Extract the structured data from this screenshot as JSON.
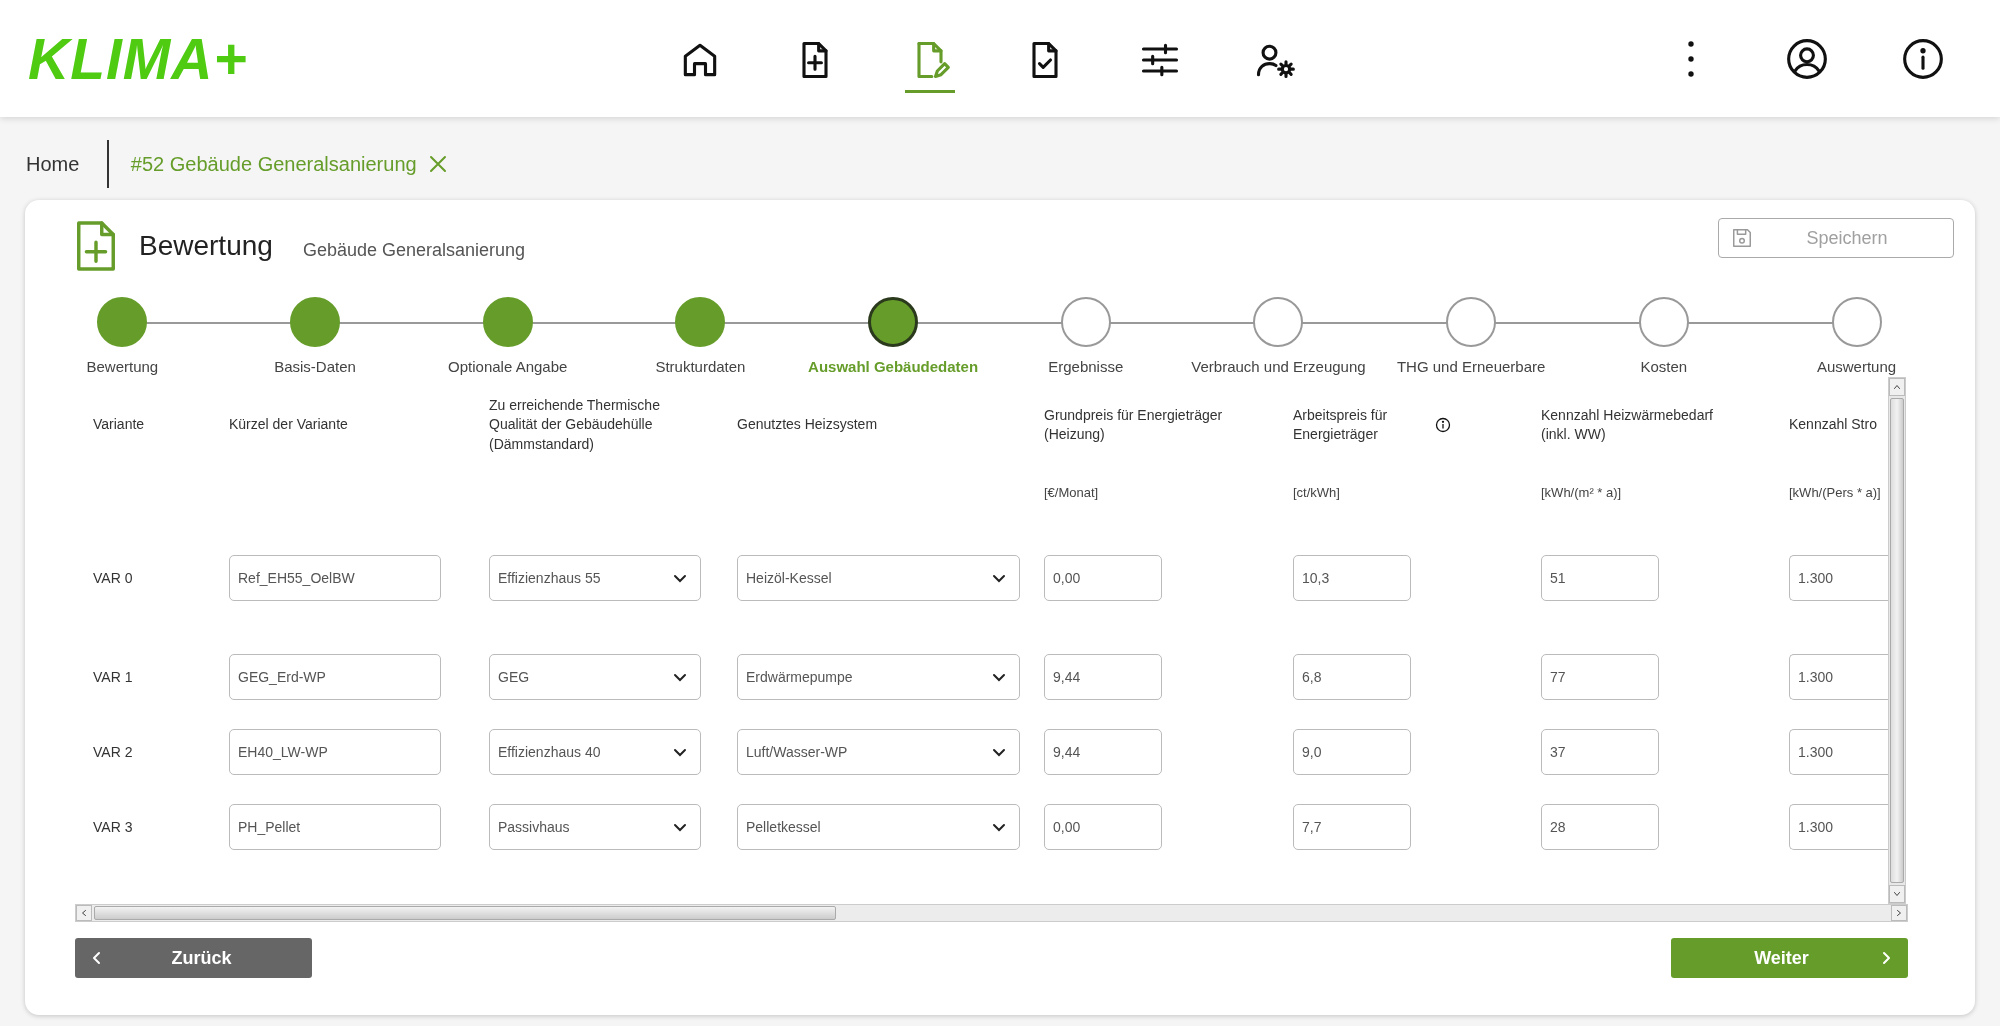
{
  "app": {
    "logo": "KLIMA+"
  },
  "nav": [
    {
      "selected": false
    },
    {
      "selected": false
    },
    {
      "selected": true
    },
    {
      "selected": false
    },
    {
      "selected": false
    },
    {
      "selected": false
    }
  ],
  "breadcrumb": [
    {
      "label": "Home",
      "selected": false,
      "closable": false
    },
    {
      "label": "#52 Gebäude Generalsanierung",
      "selected": true,
      "closable": true
    }
  ],
  "page": {
    "title": "Bewertung",
    "subtitle": "Gebäude Generalsanierung",
    "save_button": {
      "label": "Speichern",
      "disabled": true
    }
  },
  "steps": [
    {
      "label": "Bewertung",
      "done": true,
      "selected": false
    },
    {
      "label": "Basis-Daten",
      "done": true,
      "selected": false
    },
    {
      "label": "Optionale Angabe",
      "done": true,
      "selected": false
    },
    {
      "label": "Strukturdaten",
      "done": true,
      "selected": false
    },
    {
      "label": "Auswahl Gebäudedaten",
      "done": true,
      "selected": true
    },
    {
      "label": "Ergebnisse",
      "done": false,
      "selected": false
    },
    {
      "label": "Verbrauch und Erzeugung",
      "done": false,
      "selected": false
    },
    {
      "label": "THG und Erneuerbare",
      "done": false,
      "selected": false
    },
    {
      "label": "Kosten",
      "done": false,
      "selected": false
    },
    {
      "label": "Auswertung",
      "done": false,
      "selected": false
    }
  ],
  "table": {
    "columns": [
      {
        "label": "Variante"
      },
      {
        "label": "Kürzel der Variante"
      },
      {
        "label": "Zu erreichende Thermische Qualität der Gebäudehülle (Dämmstandard)"
      },
      {
        "label": "Genutztes Heizsystem"
      },
      {
        "label": "Grundpreis für Energieträger (Heizung)",
        "unit": "[€/Monat]"
      },
      {
        "label": "Arbeitspreis für Energieträger",
        "unit": "[ct/kWh]",
        "info": true
      },
      {
        "label": "Kennzahl Heizwärmebedarf (inkl. WW)",
        "unit": "[kWh/(m² * a)]"
      },
      {
        "label": "Kennzahl Stro",
        "unit": "[kWh/(Pers * a)]"
      }
    ],
    "rows": [
      {
        "cells": [
          {
            "kind": "text",
            "value": "VAR 0"
          },
          {
            "kind": "input",
            "value": "Ref_EH55_OelBW"
          },
          {
            "kind": "select",
            "value": "Effizienzhaus 55"
          },
          {
            "kind": "select",
            "value": "Heizöl-Kessel"
          },
          {
            "kind": "input",
            "value": "0,00"
          },
          {
            "kind": "input",
            "value": "10,3"
          },
          {
            "kind": "input",
            "value": "51"
          },
          {
            "kind": "input",
            "value": "1.300"
          }
        ]
      },
      {
        "cells": [
          {
            "kind": "text",
            "value": "VAR 1"
          },
          {
            "kind": "input",
            "value": "GEG_Erd-WP"
          },
          {
            "kind": "select",
            "value": "GEG"
          },
          {
            "kind": "select",
            "value": "Erdwärmepumpe"
          },
          {
            "kind": "input",
            "value": "9,44"
          },
          {
            "kind": "input",
            "value": "6,8"
          },
          {
            "kind": "input",
            "value": "77"
          },
          {
            "kind": "input",
            "value": "1.300"
          }
        ]
      },
      {
        "cells": [
          {
            "kind": "text",
            "value": "VAR 2"
          },
          {
            "kind": "input",
            "value": "EH40_LW-WP"
          },
          {
            "kind": "select",
            "value": "Effizienzhaus 40"
          },
          {
            "kind": "select",
            "value": "Luft/Wasser-WP"
          },
          {
            "kind": "input",
            "value": "9,44"
          },
          {
            "kind": "input",
            "value": "9,0"
          },
          {
            "kind": "input",
            "value": "37"
          },
          {
            "kind": "input",
            "value": "1.300"
          }
        ]
      },
      {
        "cells": [
          {
            "kind": "text",
            "value": "VAR 3"
          },
          {
            "kind": "input",
            "value": "PH_Pellet"
          },
          {
            "kind": "select",
            "value": "Passivhaus"
          },
          {
            "kind": "select",
            "value": "Pelletkessel"
          },
          {
            "kind": "input",
            "value": "0,00"
          },
          {
            "kind": "input",
            "value": "7,7"
          },
          {
            "kind": "input",
            "value": "28"
          },
          {
            "kind": "input",
            "value": "1.300"
          }
        ]
      }
    ]
  },
  "footer": {
    "back_button": "Zurück",
    "next_button": "Weiter"
  }
}
